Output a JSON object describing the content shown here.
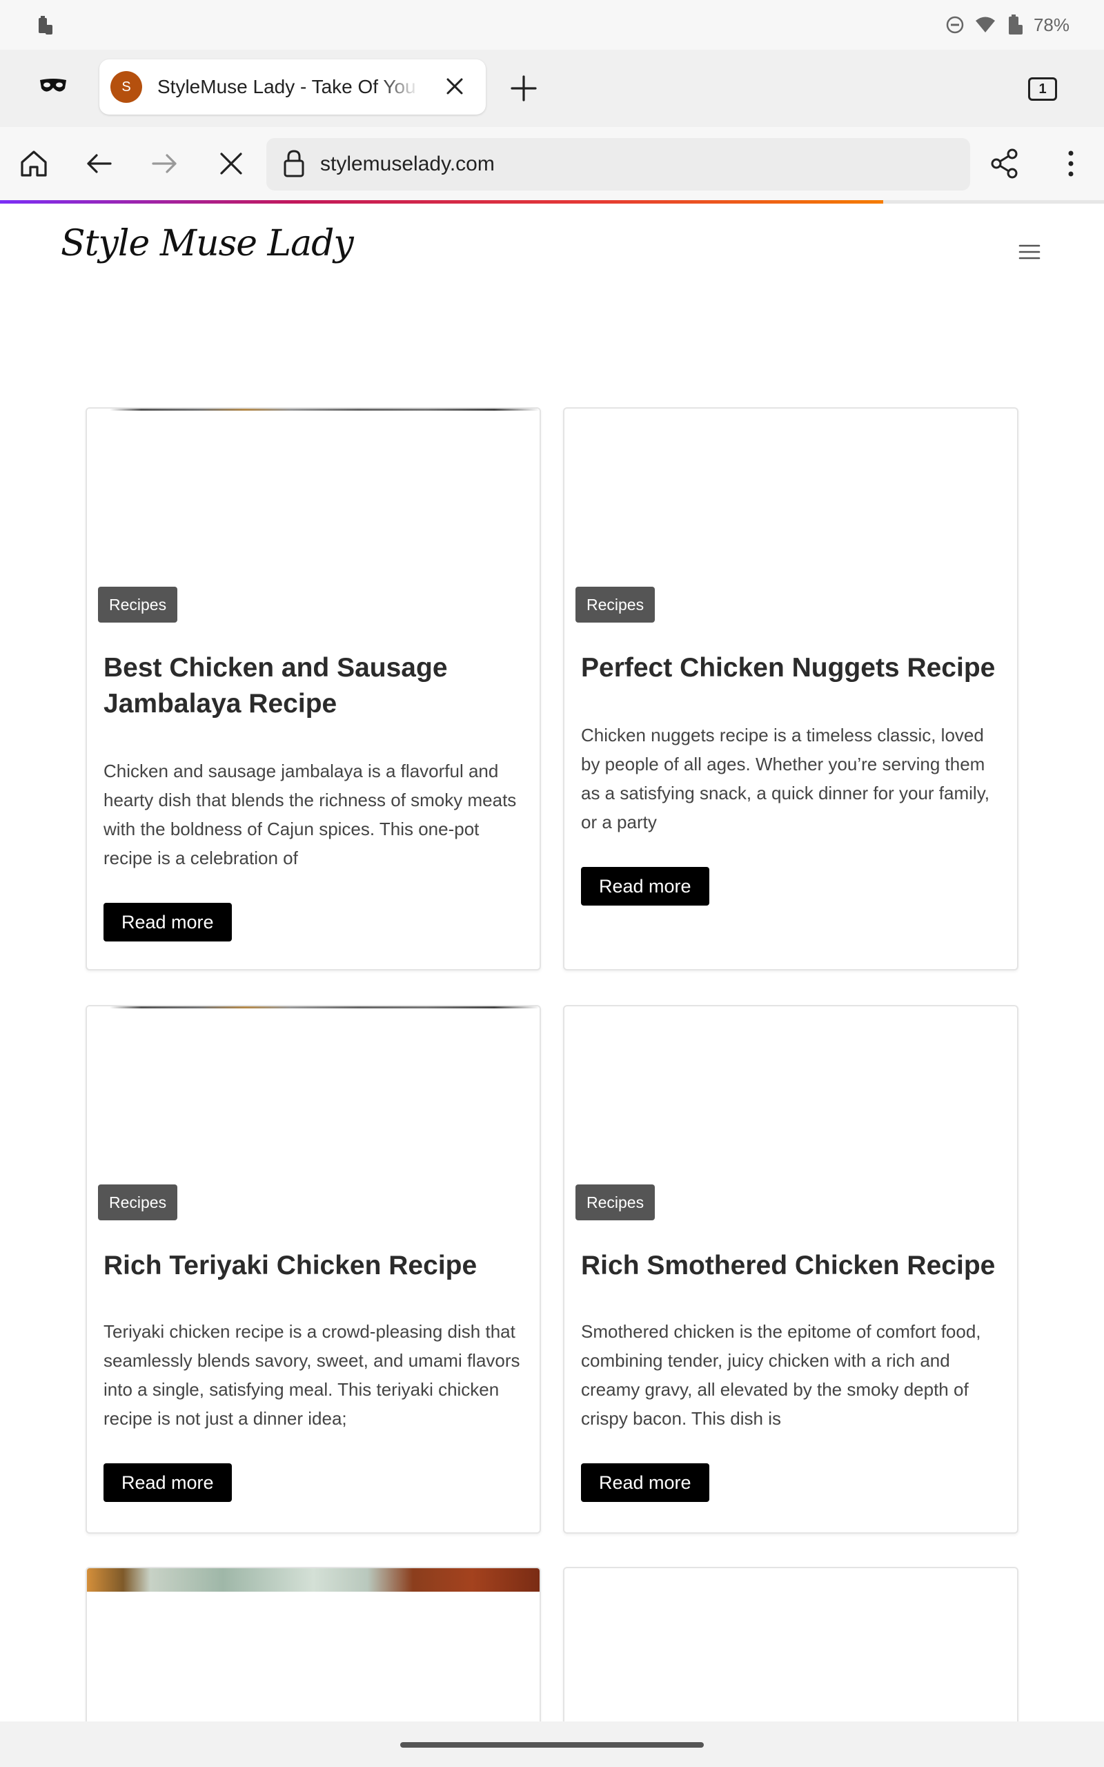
{
  "status_bar": {
    "battery_percent": "78%",
    "icons": [
      "battery-saver-icon",
      "do-not-disturb-icon",
      "wifi-icon",
      "battery-icon"
    ]
  },
  "tab_strip": {
    "private_icon": "private-mask-icon",
    "active_tab": {
      "favicon_letter": "S",
      "title": "StyleMuse Lady - Take Of You"
    },
    "tab_count": "1"
  },
  "toolbar": {
    "url": "stylemuselady.com",
    "progress": 0.8
  },
  "site": {
    "logo_text": "Style Muse Lady",
    "menu_icon": "hamburger-menu-icon"
  },
  "cards": [
    {
      "category": "Recipes",
      "title": "Best Chicken and Sausage Jambalaya Recipe",
      "excerpt": "Chicken and sausage jambalaya is a flavorful and hearty dish that blends the richness of smoky meats with the boldness of Cajun spices. This one-pot recipe is a celebration of",
      "button": "Read more"
    },
    {
      "category": "Recipes",
      "title": "Perfect Chicken Nuggets Recipe",
      "excerpt": "Chicken nuggets recipe is a timeless classic, loved by people of all ages. Whether you’re serving them as a satisfying snack, a quick dinner for your family, or a party",
      "button": "Read more"
    },
    {
      "category": "Recipes",
      "title": "Rich Teriyaki Chicken Recipe",
      "excerpt": "Teriyaki chicken recipe is a crowd-pleasing dish that seamlessly blends savory, sweet, and umami flavors into a single, satisfying meal. This teriyaki chicken recipe is not just a dinner idea;",
      "button": "Read more"
    },
    {
      "category": "Recipes",
      "title": "Rich Smothered Chicken Recipe",
      "excerpt": "Smothered chicken is the epitome of comfort food, combining tender, juicy chicken with a rich and creamy gravy, all elevated by the smoky depth of crispy bacon. This dish is",
      "button": "Read more"
    }
  ]
}
